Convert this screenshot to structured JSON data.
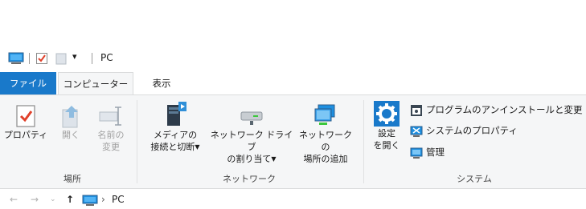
{
  "titlebar": {
    "title": "PC",
    "qat_dropdown": "▾"
  },
  "tabs": {
    "file": "ファイル",
    "computer": "コンピューター",
    "view": "表示"
  },
  "ribbon": {
    "location_group": {
      "label": "場所",
      "properties": "プロパティ",
      "open": "開く",
      "rename_line1": "名前の",
      "rename_line2": "変更"
    },
    "network_group": {
      "label": "ネットワーク",
      "media_line1": "メディアの",
      "media_line2": "接続と切断",
      "map_line1": "ネットワーク ドライブ",
      "map_line2": "の割り当て",
      "add_line1": "ネットワークの",
      "add_line2": "場所の追加"
    },
    "system_group": {
      "label": "システム",
      "settings_line1": "設定",
      "settings_line2": "を開く",
      "uninstall": "プログラムのアンインストールと変更",
      "sysprops": "システムのプロパティ",
      "manage": "管理"
    }
  },
  "address": {
    "path": "PC",
    "crumb_sep": "›"
  },
  "colors": {
    "accent": "#1979ca",
    "ribbon_bg": "#f5f6f7"
  }
}
